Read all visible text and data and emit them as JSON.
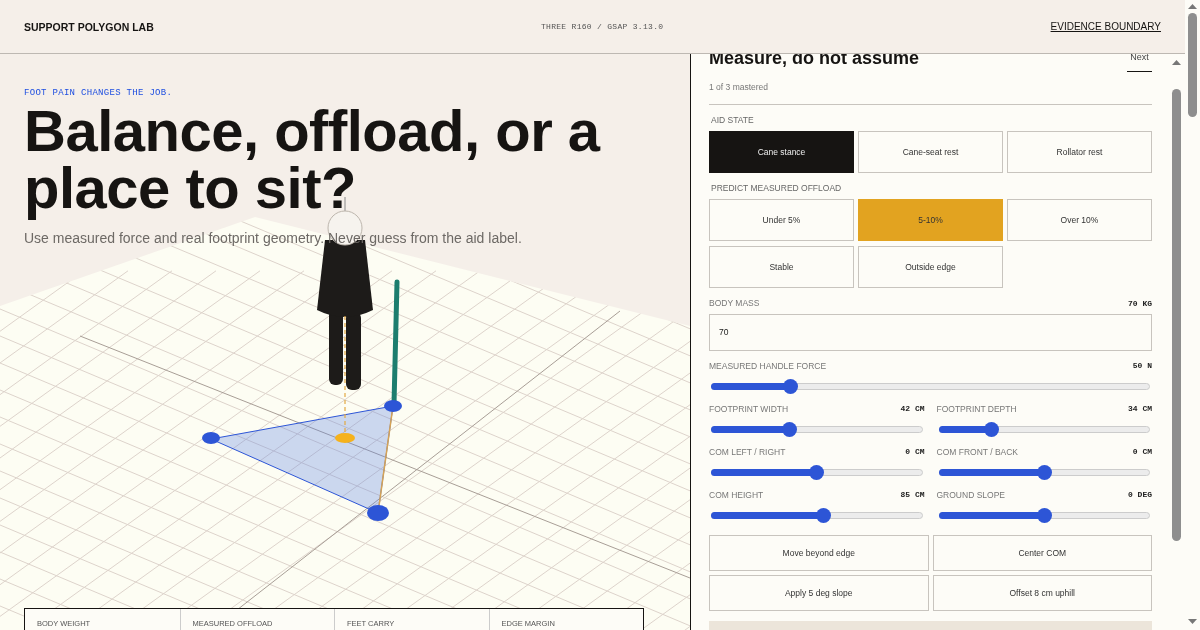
{
  "header": {
    "brand": "SUPPORT POLYGON LAB",
    "version": "THREE R160 / GSAP 3.13.0",
    "link": "EVIDENCE BOUNDARY"
  },
  "hero": {
    "eyebrow": "FOOT PAIN CHANGES THE JOB.",
    "title_lines": [
      "Balance, offload, or a",
      "place to sit?"
    ],
    "subtitle": "Use measured force and real footprint geometry. Never guess from the aid label."
  },
  "stats": {
    "columns": [
      "BODY WEIGHT",
      "MEASURED OFFLOAD",
      "FEET CARRY",
      "EDGE MARGIN"
    ]
  },
  "panel": {
    "title": "Measure, do not assume",
    "next": "Next",
    "progress": "1 of 3 mastered",
    "aid_state": {
      "label": "AID STATE",
      "options": [
        {
          "label": "Cane stance",
          "selected": true
        },
        {
          "label": "Cane-seat rest",
          "selected": false
        },
        {
          "label": "Rollator rest",
          "selected": false
        }
      ]
    },
    "prediction": {
      "label": "PREDICT MEASURED OFFLOAD",
      "options": [
        {
          "label": "Under 5%",
          "selected": false
        },
        {
          "label": "5-10%",
          "selected": true
        },
        {
          "label": "Over 10%",
          "selected": false
        },
        {
          "label": "Stable",
          "selected": false
        },
        {
          "label": "Outside edge",
          "selected": false
        }
      ]
    },
    "body_mass": {
      "label": "BODY MASS",
      "reading": "70 KG",
      "value": "70"
    },
    "handle_force": {
      "label": "MEASURED HANDLE FORCE",
      "reading": "50 N",
      "level": 0.18
    },
    "sliders": [
      {
        "label": "FOOTPRINT WIDTH",
        "reading": "42 CM",
        "level": 0.37
      },
      {
        "label": "FOOTPRINT DEPTH",
        "reading": "34 CM",
        "level": 0.25
      },
      {
        "label": "COM LEFT / RIGHT",
        "reading": "0 CM",
        "level": 0.5
      },
      {
        "label": "COM FRONT / BACK",
        "reading": "0 CM",
        "level": 0.5
      },
      {
        "label": "COM HEIGHT",
        "reading": "85 CM",
        "level": 0.53
      },
      {
        "label": "GROUND SLOPE",
        "reading": "0 DEG",
        "level": 0.5
      }
    ],
    "actions": [
      "Move beyond edge",
      "Center COM",
      "Apply 5 deg slope",
      "Offset 8 cm uphill"
    ]
  }
}
